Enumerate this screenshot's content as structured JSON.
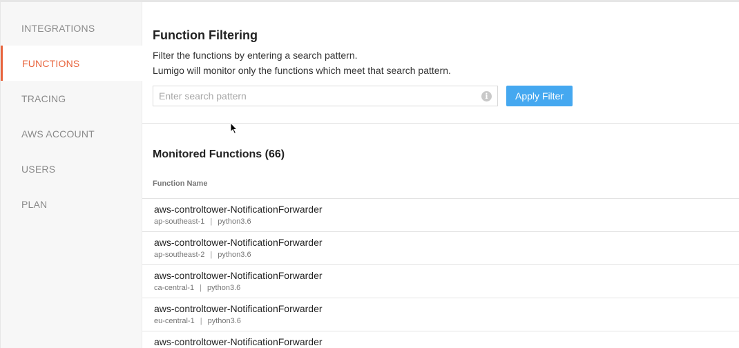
{
  "sidebar": {
    "items": [
      {
        "label": "INTEGRATIONS",
        "active": false
      },
      {
        "label": "FUNCTIONS",
        "active": true
      },
      {
        "label": "TRACING",
        "active": false
      },
      {
        "label": "AWS ACCOUNT",
        "active": false
      },
      {
        "label": "USERS",
        "active": false
      },
      {
        "label": "PLAN",
        "active": false
      }
    ]
  },
  "filter": {
    "title": "Function Filtering",
    "description_line1": "Filter the functions by entering a search pattern.",
    "description_line2": "Lumigo will monitor only the functions which meet that search pattern.",
    "search_placeholder": "Enter search pattern",
    "search_value": "",
    "info_icon": "info-icon",
    "apply_label": "Apply Filter"
  },
  "monitored": {
    "title": "Monitored Functions (66)",
    "column_header": "Function Name",
    "rows": [
      {
        "name": "aws-controltower-NotificationForwarder",
        "region": "ap-southeast-1",
        "separator": "|",
        "runtime": "python3.6"
      },
      {
        "name": "aws-controltower-NotificationForwarder",
        "region": "ap-southeast-2",
        "separator": "|",
        "runtime": "python3.6"
      },
      {
        "name": "aws-controltower-NotificationForwarder",
        "region": "ca-central-1",
        "separator": "|",
        "runtime": "python3.6"
      },
      {
        "name": "aws-controltower-NotificationForwarder",
        "region": "eu-central-1",
        "separator": "|",
        "runtime": "python3.6"
      },
      {
        "name": "aws-controltower-NotificationForwarder",
        "region": "",
        "separator": "",
        "runtime": ""
      }
    ]
  },
  "colors": {
    "accent": "#e8643c",
    "button": "#45a8f0",
    "sidebar_bg": "#f7f7f7"
  }
}
